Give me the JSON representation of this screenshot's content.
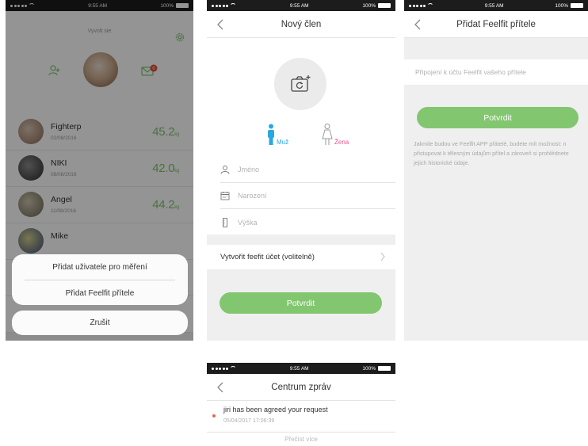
{
  "status_bar": {
    "carrier": "•••••",
    "time": "9:55 AM",
    "battery": "100%"
  },
  "screen1": {
    "header_title": "Vyvolt sie",
    "badge_count": "0",
    "members": [
      {
        "name": "Fighterp",
        "date": "02/08/2016",
        "weight": "45.2",
        "unit": "kg"
      },
      {
        "name": "NIKI",
        "date": "08/08/2016",
        "weight": "42.0",
        "unit": "kg"
      },
      {
        "name": "Angel",
        "date": "11/08/2016",
        "weight": "44.2",
        "unit": "kg"
      },
      {
        "name": "Mike",
        "date": "",
        "weight": "",
        "unit": ""
      }
    ],
    "action_sheet": {
      "add_measure_user": "Přidat uživatele pro měření",
      "add_friend": "Přidat Feelfit přítele",
      "cancel": "Zrušit"
    }
  },
  "screen2": {
    "title": "Nový člen",
    "gender_male": "Muž",
    "gender_female": "Žena",
    "name_placeholder": "Jméno",
    "birth_placeholder": "Narození",
    "height_placeholder": "Výška",
    "create_account": "Vytvořit feefit účet (volitelně)",
    "confirm": "Potvrdit"
  },
  "screen3": {
    "title": "Přidat Feelfit přítele",
    "input_placeholder": "Připojení k účtu Feelfit vašeho přítele",
    "confirm": "Potvrdit",
    "note": "Jakmile budou ve Feelfit APP přátelé, budete mít možnost: n přistupovat k tělesným údajům přítel a zároveň si prohlédnete jejich historické údaje."
  },
  "screen4": {
    "title": "Centrum zpráv",
    "message_text": "jiri has been agreed your request",
    "message_time": "05/04/2017 17:06:39",
    "read_more": "Přečíst více"
  },
  "colors": {
    "accent_green": "#82c66f",
    "weight_green": "#7fc46f",
    "male_blue": "#29a8e0",
    "female_pink": "#e8578c",
    "unread_orange": "#e36c3e",
    "status_bar": "#1c1c1c"
  }
}
